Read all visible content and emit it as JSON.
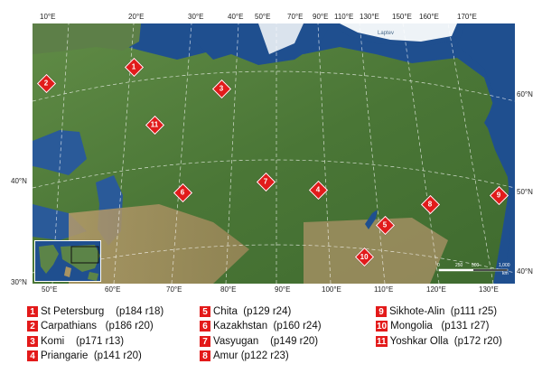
{
  "map": {
    "top_ticks": [
      "10°E",
      "20°E",
      "30°E",
      "40°E",
      "50°E",
      "70°E",
      "90°E",
      "110°E",
      "130°E",
      "150°E",
      "160°E",
      "170°E"
    ],
    "bottom_ticks": [
      "50°E",
      "60°E",
      "70°E",
      "80°E",
      "90°E",
      "100°E",
      "110°E",
      "120°E",
      "130°E"
    ],
    "left_ticks": [
      "40°N",
      "30°N"
    ],
    "right_ticks": [
      "60°N",
      "50°N",
      "40°N"
    ],
    "sea_label": "Laptev",
    "scale_labels": [
      "0",
      "250",
      "500",
      "1,000"
    ],
    "scale_unit": "km"
  },
  "sites": [
    {
      "num": "1",
      "name": "St Petersburg",
      "code": "(p184 r18)"
    },
    {
      "num": "2",
      "name": "Carpathians",
      "code": "(p186 r20)"
    },
    {
      "num": "3",
      "name": "Komi",
      "code": "(p171 r13)"
    },
    {
      "num": "4",
      "name": "Priangarie",
      "code": "(p141 r20)"
    },
    {
      "num": "5",
      "name": "Chita",
      "code": "(p129 r24)"
    },
    {
      "num": "6",
      "name": "Kazakhstan",
      "code": "(p160 r24)"
    },
    {
      "num": "7",
      "name": "Vasyugan",
      "code": "(p149 r20)"
    },
    {
      "num": "8",
      "name": "Amur",
      "code": "(p122 r23)"
    },
    {
      "num": "9",
      "name": "Sikhote-Alin",
      "code": "(p111 r25)"
    },
    {
      "num": "10",
      "name": "Mongolia",
      "code": "(p131 r27)"
    },
    {
      "num": "11",
      "name": "Yoshkar Olla",
      "code": "(p172 r20)"
    }
  ],
  "colors": {
    "marker": "#e11b1b",
    "ocean": "#1f4f8f",
    "land": "#4f7a3a",
    "ice": "#eef3f7",
    "graticule": "#ffffff"
  }
}
